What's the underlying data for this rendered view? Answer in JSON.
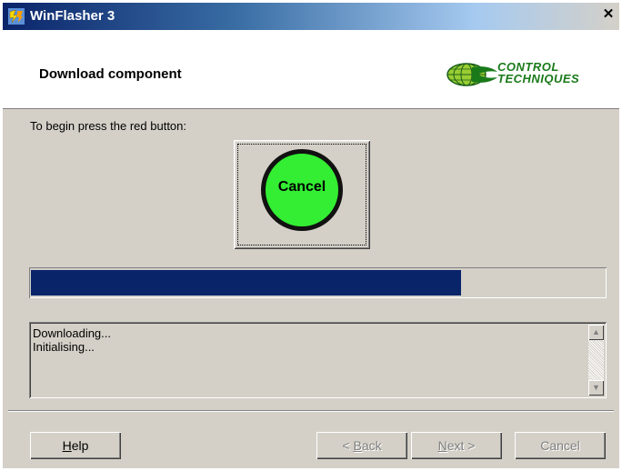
{
  "window": {
    "title": "WinFlasher 3",
    "close_glyph": "✕",
    "icon": "winflasher-app-icon"
  },
  "header": {
    "title": "Download component",
    "logo_text_line1": "CONTROL",
    "logo_text_line2": "TECHNIQUES"
  },
  "main": {
    "instruction": "To begin press the red button:",
    "action_button_label": "Cancel",
    "progress_fraction": 0.75,
    "log_lines": [
      "Downloading...",
      "Initialising..."
    ]
  },
  "footer": {
    "help": {
      "mnemonic": "H",
      "rest": "elp"
    },
    "back": {
      "prefix": "< ",
      "mnemonic": "B",
      "rest": "ack"
    },
    "next": {
      "mnemonic": "N",
      "rest": "ext >"
    },
    "cancel": "Cancel"
  },
  "colors": {
    "progress_fill": "#0a246a",
    "button_circle": "#33ee33",
    "logo_green": "#1a7a1a"
  }
}
